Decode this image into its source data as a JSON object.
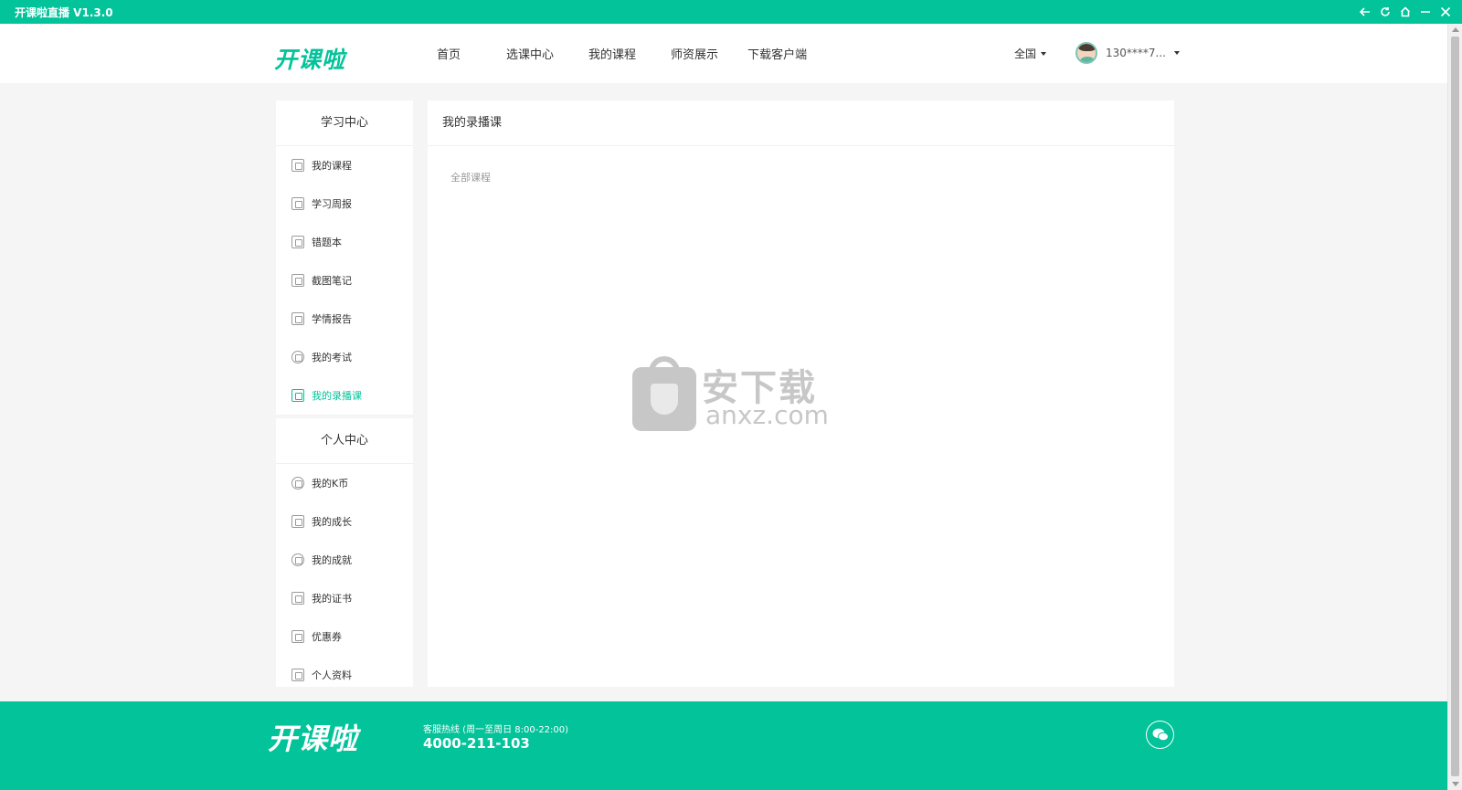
{
  "window": {
    "title": "开课啦直播 V1.3.0"
  },
  "header": {
    "logo": "开课啦",
    "nav": [
      "首页",
      "选课中心",
      "我的课程",
      "师资展示",
      "下载客户端"
    ],
    "region": "全国",
    "user_name": "130****7..."
  },
  "sidebar": {
    "study_title": "学习中心",
    "study_items": [
      "我的课程",
      "学习周报",
      "错题本",
      "截图笔记",
      "学情报告",
      "我的考试",
      "我的录播课"
    ],
    "personal_title": "个人中心",
    "personal_items": [
      "我的K币",
      "我的成长",
      "我的成就",
      "我的证书",
      "优惠券",
      "个人资料"
    ],
    "active_item": "我的录播课"
  },
  "main": {
    "title": "我的录播课",
    "filter": "全部课程"
  },
  "watermark": {
    "cn": "安下载",
    "en": "anxz.com"
  },
  "footer": {
    "logo": "开课啦",
    "hotline_label": "客服热线 (周一至周日 8:00-22:00)",
    "hotline_phone": "4000-211-103"
  },
  "colors": {
    "brand": "#02c39a",
    "background": "#f5f5f5",
    "panel": "#ffffff"
  }
}
